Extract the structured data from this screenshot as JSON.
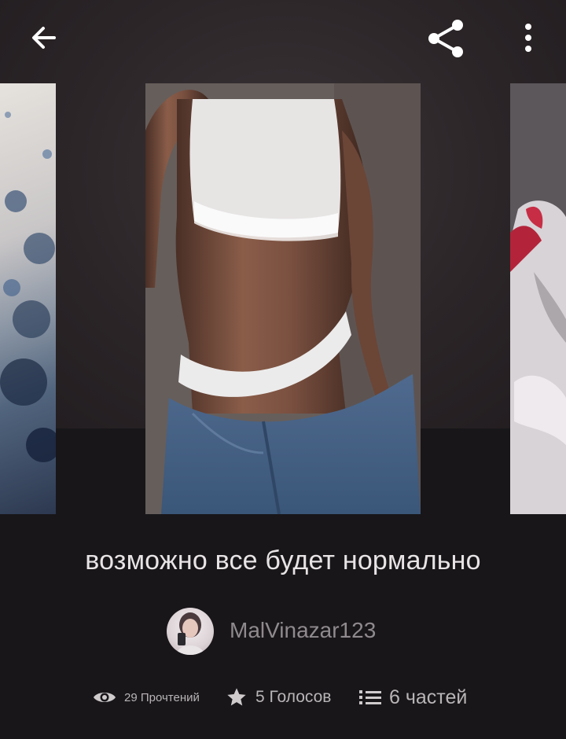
{
  "header": {
    "back_icon": "arrow-left-icon",
    "share_icon": "share-icon",
    "more_icon": "vertical-dots-icon"
  },
  "story": {
    "title": "возможно все будет нормально",
    "author": "MalVinazar123"
  },
  "stats": {
    "reads": "29 Прочтений",
    "votes": "5 Голосов",
    "parts": "6 частей"
  },
  "colors": {
    "background": "#181619",
    "text_primary": "#e8e4e6",
    "text_secondary": "#8f8a8d"
  }
}
